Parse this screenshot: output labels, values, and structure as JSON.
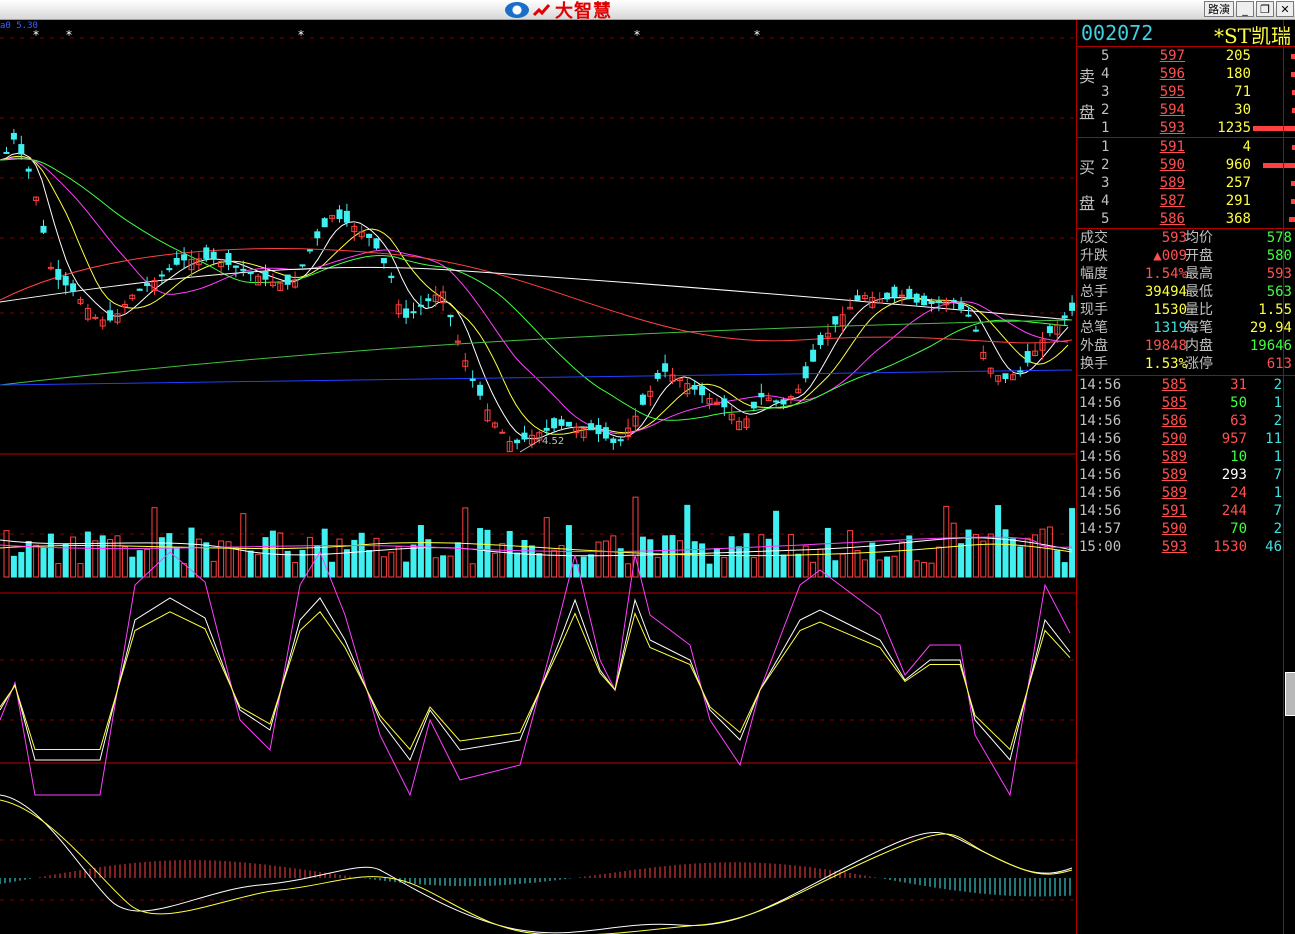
{
  "window": {
    "brand_text": "大智慧",
    "buttons": [
      "路演",
      "_",
      "❐",
      "✕"
    ]
  },
  "chart_header": {
    "ma_label": "a0 5.30",
    "low_marker": "4.52"
  },
  "colors": {
    "up": "#ff4040",
    "down": "#40f0f0",
    "grid": "#800000"
  },
  "stock": {
    "code": "002072",
    "name": "*ST凯瑞"
  },
  "orderbook": {
    "sell_label_1": "卖",
    "sell_label_2": "盘",
    "buy_label_1": "买",
    "buy_label_2": "盘",
    "sell": [
      {
        "level": "5",
        "price": "597",
        "vol": "205",
        "bar": 0.02
      },
      {
        "level": "4",
        "price": "596",
        "vol": "180",
        "bar": 0.02
      },
      {
        "level": "3",
        "price": "595",
        "vol": "71",
        "bar": 0.01
      },
      {
        "level": "2",
        "price": "594",
        "vol": "30",
        "bar": 0.01
      },
      {
        "level": "1",
        "price": "593",
        "vol": "1235",
        "bar": 0.2
      }
    ],
    "buy": [
      {
        "level": "1",
        "price": "591",
        "vol": "4",
        "bar": 0.01
      },
      {
        "level": "2",
        "price": "590",
        "vol": "960",
        "bar": 0.15
      },
      {
        "level": "3",
        "price": "589",
        "vol": "257",
        "bar": 0.02
      },
      {
        "level": "4",
        "price": "587",
        "vol": "291",
        "bar": 0.02
      },
      {
        "level": "5",
        "price": "586",
        "vol": "368",
        "bar": 0.03
      }
    ]
  },
  "stats": [
    {
      "k": "成交",
      "v": "593",
      "vc": "#ff5050",
      "k2": "均价",
      "v2": "578",
      "v2c": "#40ff40"
    },
    {
      "k": "升跌",
      "v": "▲009",
      "vc": "#ff5050",
      "k2": "开盘",
      "v2": "580",
      "v2c": "#40ff40"
    },
    {
      "k": "幅度",
      "v": "1.54%",
      "vc": "#ff5050",
      "k2": "最高",
      "v2": "593",
      "v2c": "#ff5050"
    },
    {
      "k": "总手",
      "v": "39494",
      "vc": "#ffff40",
      "k2": "最低",
      "v2": "563",
      "v2c": "#40ff40"
    },
    {
      "k": "现手",
      "v": "1530",
      "vc": "#ffff40",
      "k2": "量比",
      "v2": "1.55",
      "v2c": "#ffff40"
    },
    {
      "k": "总笔",
      "v": "1319",
      "vc": "#40e0e0",
      "k2": "每笔",
      "v2": "29.94",
      "v2c": "#ffff40"
    },
    {
      "k": "外盘",
      "v": "19848",
      "vc": "#ff5050",
      "k2": "内盘",
      "v2": "19646",
      "v2c": "#40ff40"
    },
    {
      "k": "换手",
      "v": "1.53%",
      "vc": "#ffff40",
      "k2": "涨停",
      "v2": "613",
      "v2c": "#ff5050"
    }
  ],
  "ticks": [
    {
      "t": "14:56",
      "p": "585",
      "q": "31",
      "n": "2",
      "c": "#ff5050"
    },
    {
      "t": "14:56",
      "p": "585",
      "q": "50",
      "n": "1",
      "c": "#40ff40"
    },
    {
      "t": "14:56",
      "p": "586",
      "q": "63",
      "n": "2",
      "c": "#ff5050"
    },
    {
      "t": "14:56",
      "p": "590",
      "q": "957",
      "n": "11",
      "c": "#ff5050"
    },
    {
      "t": "14:56",
      "p": "589",
      "q": "10",
      "n": "1",
      "c": "#40ff40"
    },
    {
      "t": "14:56",
      "p": "589",
      "q": "293",
      "n": "7",
      "c": "#ffffff"
    },
    {
      "t": "14:56",
      "p": "589",
      "q": "24",
      "n": "1",
      "c": "#ff5050"
    },
    {
      "t": "14:56",
      "p": "591",
      "q": "244",
      "n": "7",
      "c": "#ff5050"
    },
    {
      "t": "14:57",
      "p": "590",
      "q": "70",
      "n": "2",
      "c": "#40ff40"
    },
    {
      "t": "15:00",
      "p": "593",
      "q": "1530",
      "n": "46",
      "c": "#ff5050"
    }
  ]
}
